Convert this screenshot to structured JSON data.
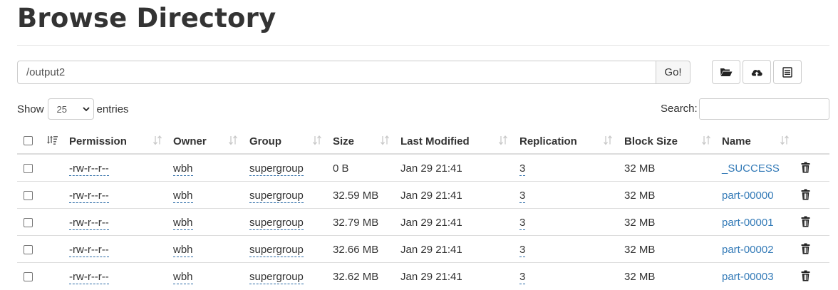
{
  "page": {
    "title": "Browse Directory"
  },
  "path_bar": {
    "value": "/output2",
    "go_label": "Go!"
  },
  "toolbar": {
    "icons": [
      "folder-open-icon",
      "cloud-upload-icon",
      "list-icon"
    ]
  },
  "length": {
    "show_label": "Show",
    "selected": "25",
    "entries_label": "entries"
  },
  "search": {
    "label": "Search:",
    "value": ""
  },
  "table": {
    "columns": [
      "Permission",
      "Owner",
      "Group",
      "Size",
      "Last Modified",
      "Replication",
      "Block Size",
      "Name"
    ],
    "rows": [
      {
        "permission": "-rw-r--r--",
        "owner": "wbh",
        "group": "supergroup",
        "size": "0 B",
        "modified": "Jan 29 21:41",
        "replication": "3",
        "block_size": "32 MB",
        "name": "_SUCCESS"
      },
      {
        "permission": "-rw-r--r--",
        "owner": "wbh",
        "group": "supergroup",
        "size": "32.59 MB",
        "modified": "Jan 29 21:41",
        "replication": "3",
        "block_size": "32 MB",
        "name": "part-00000"
      },
      {
        "permission": "-rw-r--r--",
        "owner": "wbh",
        "group": "supergroup",
        "size": "32.79 MB",
        "modified": "Jan 29 21:41",
        "replication": "3",
        "block_size": "32 MB",
        "name": "part-00001"
      },
      {
        "permission": "-rw-r--r--",
        "owner": "wbh",
        "group": "supergroup",
        "size": "32.66 MB",
        "modified": "Jan 29 21:41",
        "replication": "3",
        "block_size": "32 MB",
        "name": "part-00002"
      },
      {
        "permission": "-rw-r--r--",
        "owner": "wbh",
        "group": "supergroup",
        "size": "32.62 MB",
        "modified": "Jan 29 21:41",
        "replication": "3",
        "block_size": "32 MB",
        "name": "part-00003"
      }
    ]
  }
}
